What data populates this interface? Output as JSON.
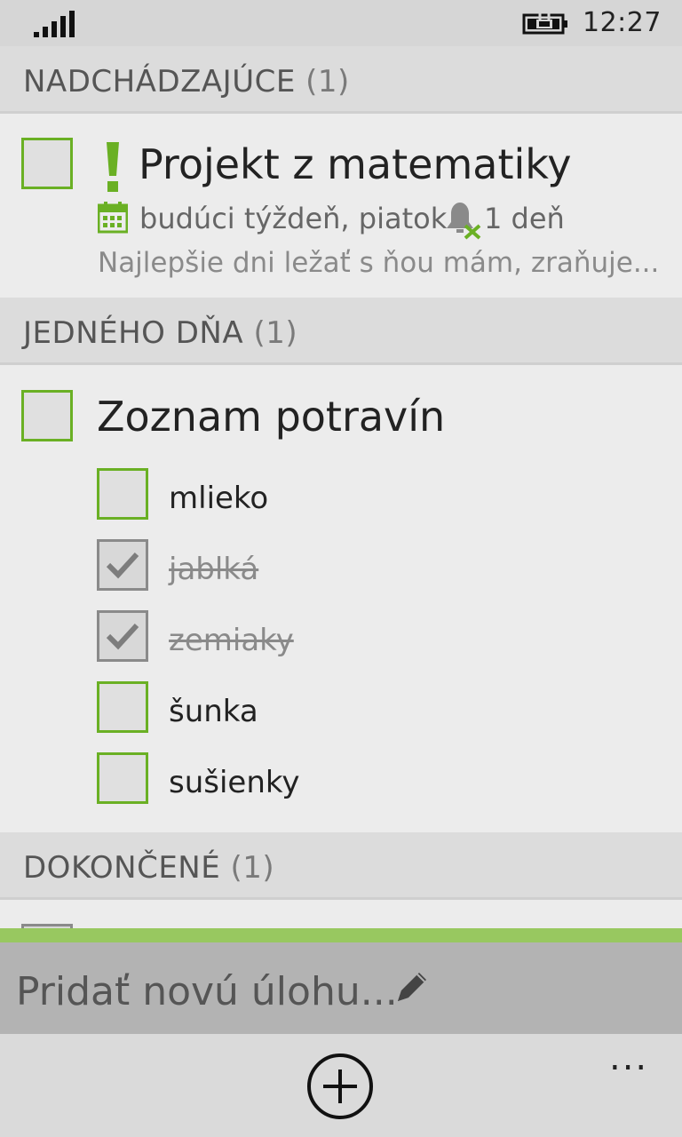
{
  "status": {
    "time": "12:27",
    "signal_icon": "signal-icon",
    "battery_icon": "battery-charging-icon"
  },
  "sections": {
    "upcoming": {
      "title": "NADCHÁDZAJÚCE",
      "count": "(1)"
    },
    "someday": {
      "title": "JEDNÉHO DŇA",
      "count": "(1)"
    },
    "completed": {
      "title": "DOKONČENÉ",
      "count": "(1)"
    }
  },
  "task_project": {
    "title": "Projekt z matematiky",
    "priority": "!",
    "due": "budúci týždeň, piatok",
    "reminder": "1 deň",
    "note": "Najlepšie dni ležať s ňou mám, zraňuje..."
  },
  "task_grocery": {
    "title": "Zoznam potravín",
    "items": [
      {
        "label": "mlieko",
        "done": false
      },
      {
        "label": "jablká",
        "done": true
      },
      {
        "label": "zemiaky",
        "done": true
      },
      {
        "label": "šunka",
        "done": false
      },
      {
        "label": "sušienky",
        "done": false
      }
    ]
  },
  "add_bar": {
    "placeholder": "Pridať novú úlohu..."
  },
  "appbar": {
    "more": "..."
  },
  "colors": {
    "accent": "#6ab024",
    "header_bg": "#dcdcdc",
    "page_bg": "#ececec",
    "add_bar_bg": "#b3b3b3"
  }
}
